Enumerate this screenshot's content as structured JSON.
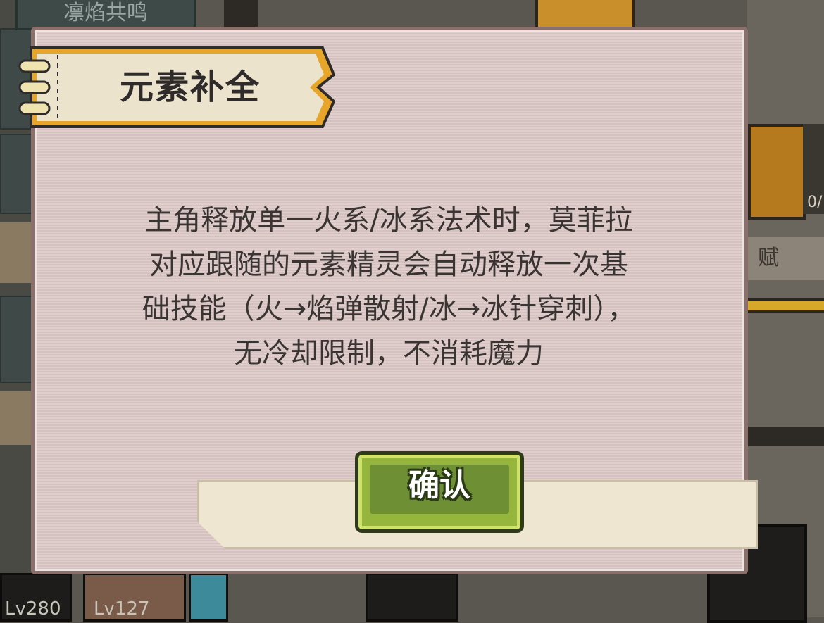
{
  "background": {
    "top_tab_label": "凛焰共鸣",
    "talent_label": "赋",
    "level_left": "Lv280",
    "level_mid": "Lv127",
    "side_count": "0/"
  },
  "dialog": {
    "title": "元素补全",
    "body_lines": [
      "主角释放单一火系/冰系法术时，莫菲拉",
      "对应跟随的元素精灵会自动释放一次基",
      "础技能（火→焰弹散射/冰→冰针穿刺），",
      "无冷却限制，不消耗魔力"
    ],
    "confirm_label": "确认"
  },
  "colors": {
    "dialog_bg": "#dcc8c6",
    "ribbon_orange": "#e7a52a",
    "confirm_green": "#95b53c"
  }
}
